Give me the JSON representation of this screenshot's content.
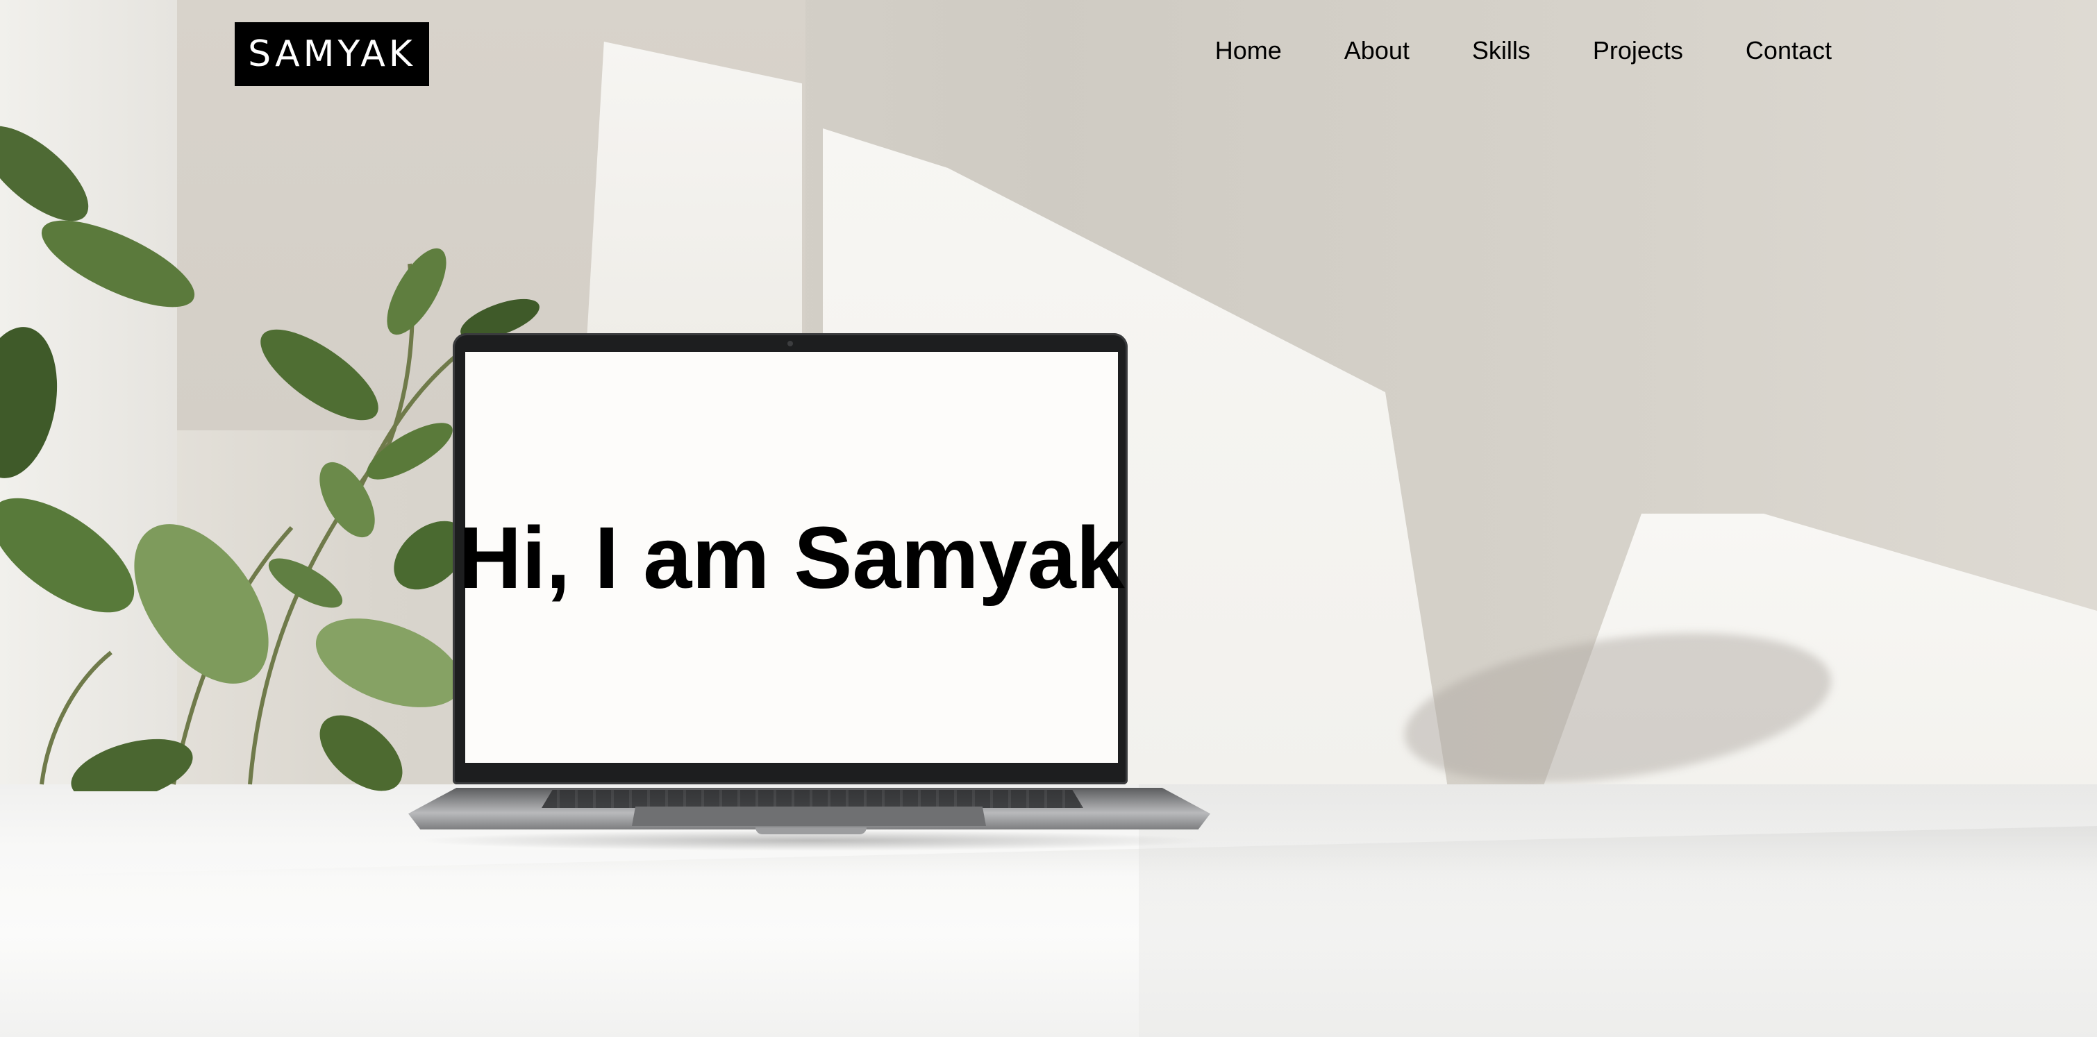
{
  "navbar": {
    "logo_text": "SAMYAK",
    "links": [
      {
        "label": "Home"
      },
      {
        "label": "About"
      },
      {
        "label": "Skills"
      },
      {
        "label": "Projects"
      },
      {
        "label": "Contact"
      }
    ]
  },
  "hero": {
    "title": "Hi, I am Samyak"
  }
}
